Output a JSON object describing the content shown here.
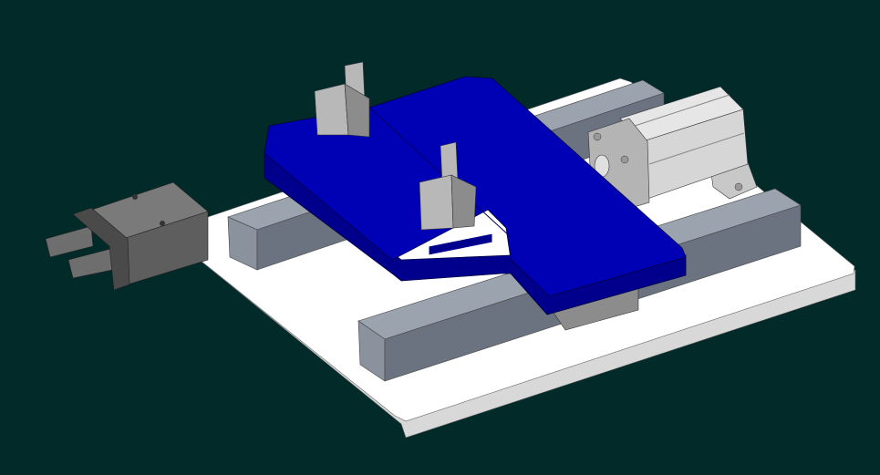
{
  "viewport": {
    "background_color": "#022a29"
  },
  "model": {
    "colors": {
      "base_plate_top": "#ffffff",
      "base_plate_edge": "#d8d8d8",
      "rail_top": "#9aa3ae",
      "rail_front": "#6b7380",
      "rail_end": "#8a929e",
      "slide_plate_top": "#0000b4",
      "slide_plate_side": "#00008c",
      "pin_light": "#b8b8b8",
      "pin_dark": "#8c8c8c",
      "cylinder_body": "#e6e6e6",
      "cylinder_shade": "#b4b4b4",
      "gripper_body": "#6e6e6e",
      "gripper_dark": "#4a4a4a"
    }
  }
}
